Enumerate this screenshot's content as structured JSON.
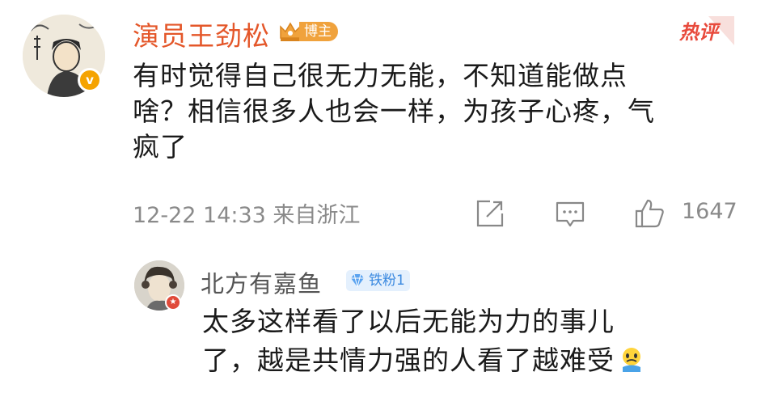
{
  "main_comment": {
    "username": "演员王劲松",
    "badge_label": "博主",
    "hot_label": "热评",
    "text_lines": [
      "有时觉得自己很无力无能，不知道能做点",
      "啥？相信很多人也会一样，为孩子心疼，气",
      "疯了"
    ],
    "timestamp": "12-22 14:33 来自浙江",
    "like_count": "1647",
    "verify_icon_glyph": "v"
  },
  "reply": {
    "username": "北方有嘉鱼",
    "fan_badge_label": "铁粉1",
    "text_lines": [
      "太多这样看了以后无能为力的事儿",
      "了，越是共情力强的人看了越难受"
    ],
    "emoji_name": "sad-face-emoji"
  },
  "colors": {
    "username_main": "#e4572a",
    "hot": "#e84a3c",
    "fan_badge": "#3a89e0",
    "meta": "#8a8a8a"
  }
}
